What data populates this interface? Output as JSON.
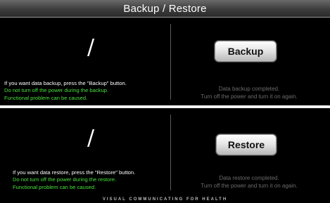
{
  "title": "Backup / Restore",
  "backup": {
    "progress_glyph": "/",
    "instruction": "If you want data backup, press the \"Backup\" button.",
    "warning_line1": "Do not turn off the power during the backup.",
    "warning_line2": "Functional problem can be caused.",
    "button_label": "Backup",
    "status_line1": "Data backup completed.",
    "status_line2": "Turn off the power and turn it on again."
  },
  "restore": {
    "progress_glyph": "/",
    "instruction": "If you want data restore, press the \"Restore\" button.",
    "warning_line1": "Do not turn off the power during the restore.",
    "warning_line2": "Functional problem can be caused.",
    "button_label": "Restore",
    "status_line1": "Data restore completed.",
    "status_line2": "Turn off the power and turn it on again."
  },
  "footer": "VISUAL COMMUNICATING FOR HEALTH",
  "colors": {
    "background": "#000000",
    "warning": "#47e23c",
    "status": "#6b6b6b",
    "divider": "#f2f2f2"
  }
}
